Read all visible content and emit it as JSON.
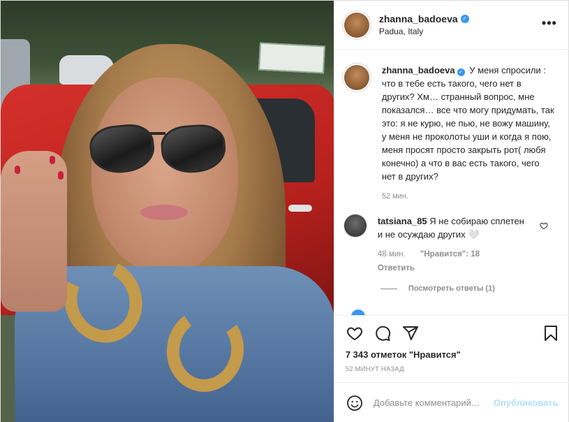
{
  "post": {
    "username": "zhanna_badoeva",
    "location": "Padua, Italy",
    "more_label": "•••",
    "caption": "У меня спросили : что в тебе есть такого, чего нет в других? Хм… странный вопрос, мне показался… все что могу придумать, так это: я не курю, не пью, не вожу машину, у меня не проколоты уши и когда я пою, меня просят просто закрыть рот( любя конечно) а что в вас есть такого, чего нет в других?",
    "caption_time": "52 мин."
  },
  "comments": [
    {
      "username": "tatsiana_85",
      "text": "Я не собираю сплетен и не осуждаю других 🤍",
      "time": "48 мин.",
      "likes": "\"Нравится\": 18",
      "reply_label": "Ответить"
    }
  ],
  "view_replies": "Посмотреть ответы (1)",
  "actions": {
    "like_icon": "heart-icon",
    "comment_icon": "comment-icon",
    "share_icon": "share-icon",
    "save_icon": "bookmark-icon"
  },
  "likes_count": "7 343 отметок \"Нравится\"",
  "post_time": "52 МИНУТ НАЗАД",
  "add_comment": {
    "placeholder": "Добавьте комментарий…",
    "publish_label": "Опубликовать"
  },
  "colors": {
    "accent": "#3897f0",
    "publish_disabled": "#b2dffc",
    "muted": "#8e8e8e"
  }
}
